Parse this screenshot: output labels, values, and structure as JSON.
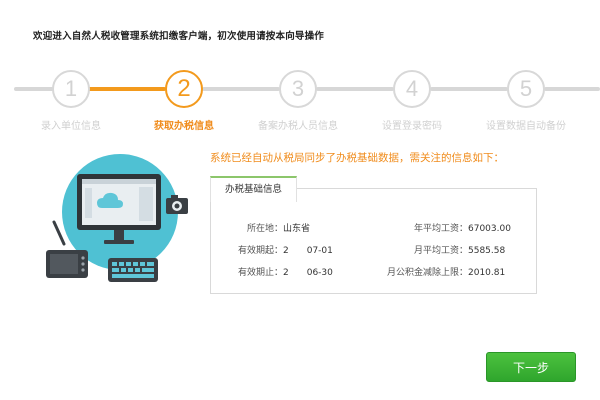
{
  "header": {
    "title": "欢迎进入自然人税收管理系统扣缴客户端，初次使用请按本向导操作"
  },
  "steps": [
    {
      "number": "1",
      "label": "录入单位信息",
      "active": false
    },
    {
      "number": "2",
      "label": "获取办税信息",
      "active": true
    },
    {
      "number": "3",
      "label": "备案办税人员信息",
      "active": false
    },
    {
      "number": "4",
      "label": "设置登录密码",
      "active": false
    },
    {
      "number": "5",
      "label": "设置数据自动备份",
      "active": false
    }
  ],
  "notice": "系统已经自动从税局同步了办税基础数据，需关注的信息如下：",
  "panel": {
    "tab_label": "办税基础信息",
    "location_label": "所在地：",
    "location_value": "山东省",
    "valid_from_label": "有效期起：",
    "valid_from_value": "2　　07-01",
    "valid_to_label": "有效期止：",
    "valid_to_value": "2　　06-30",
    "avg_salary_year_label": "年平均工资：",
    "avg_salary_year_value": "67003.00",
    "avg_salary_month_label": "月平均工资：",
    "avg_salary_month_value": "5585.58",
    "fund_cap_label": "月公积金减除上限：",
    "fund_cap_value": "2010.81"
  },
  "buttons": {
    "next": "下一步"
  },
  "colors": {
    "accent": "#f39a1d",
    "inactive": "#d7d7d7",
    "button": "#3cb538",
    "illustration": "#4fc1d3"
  }
}
